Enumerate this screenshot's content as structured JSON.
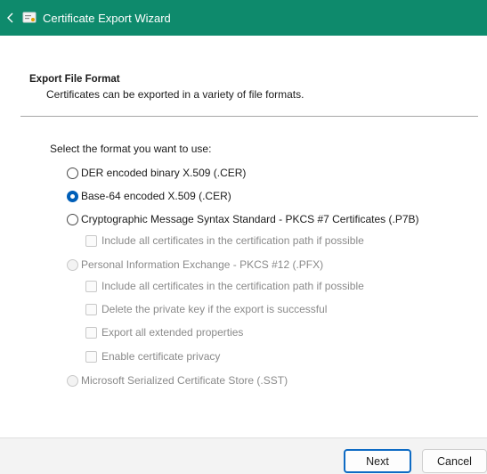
{
  "window": {
    "title": "Certificate Export Wizard"
  },
  "header": {
    "title": "Export File Format",
    "description": "Certificates can be exported in a variety of file formats."
  },
  "form": {
    "prompt": "Select the format you want to use:",
    "options": {
      "der": "DER encoded binary X.509 (.CER)",
      "base64": "Base-64 encoded X.509 (.CER)",
      "pkcs7": "Cryptographic Message Syntax Standard - PKCS #7 Certificates (.P7B)",
      "pkcs7_include_all": "Include all certificates in the certification path if possible",
      "pfx": "Personal Information Exchange - PKCS #12 (.PFX)",
      "pfx_include_all": "Include all certificates in the certification path if possible",
      "pfx_delete_key": "Delete the private key if the export is successful",
      "pfx_export_ext": "Export all extended properties",
      "pfx_privacy": "Enable certificate privacy",
      "sst": "Microsoft Serialized Certificate Store (.SST)"
    },
    "selected": "base64"
  },
  "footer": {
    "next_label": "Next",
    "cancel_label": "Cancel"
  },
  "colors": {
    "titlebar": "#0e8a6c",
    "accent": "#005fb8"
  }
}
